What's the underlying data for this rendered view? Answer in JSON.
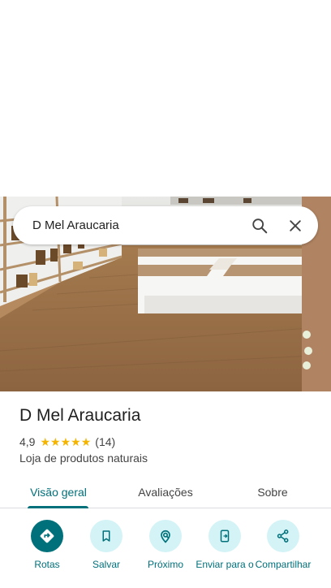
{
  "search": {
    "query": "D Mel Araucaria"
  },
  "place": {
    "name": "D Mel Araucaria",
    "rating": "4,9",
    "stars": 5,
    "review_count": "(14)",
    "category": "Loja de produtos naturais"
  },
  "tabs": [
    {
      "label": "Visão geral",
      "active": true
    },
    {
      "label": "Avaliações",
      "active": false
    },
    {
      "label": "Sobre",
      "active": false
    }
  ],
  "actions": [
    {
      "label": "Rotas",
      "icon": "directions-icon",
      "primary": true
    },
    {
      "label": "Salvar",
      "icon": "bookmark-icon",
      "primary": false
    },
    {
      "label": "Próximo",
      "icon": "nearby-icon",
      "primary": false
    },
    {
      "label": "Enviar para o",
      "icon": "send-to-phone-icon",
      "primary": false
    },
    {
      "label": "Compartilhar",
      "icon": "share-icon",
      "primary": false
    }
  ],
  "colors": {
    "accent": "#00707a",
    "accent_light": "#d3f3f6",
    "star": "#f4b400"
  }
}
